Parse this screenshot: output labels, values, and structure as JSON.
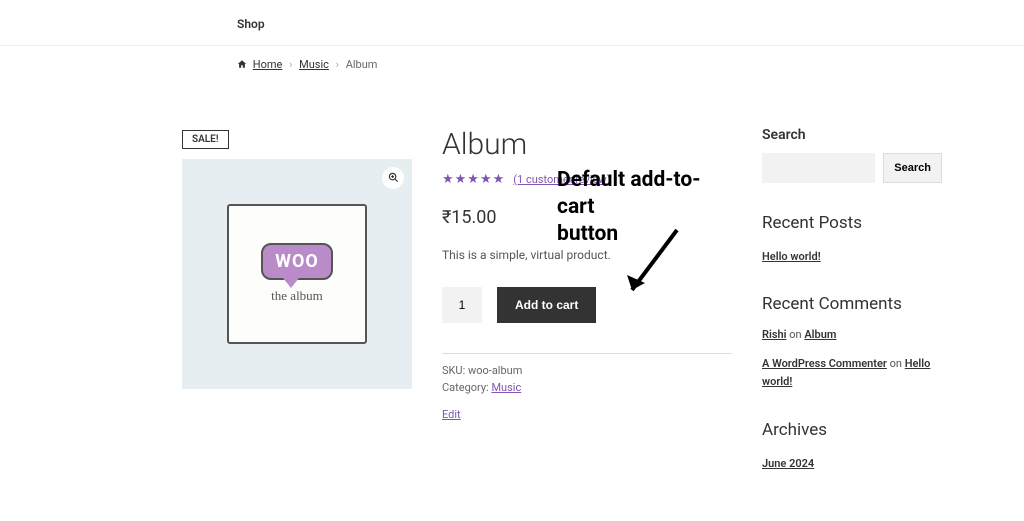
{
  "nav": {
    "shop": "Shop"
  },
  "breadcrumb": {
    "home": "Home",
    "music": "Music",
    "current": "Album"
  },
  "product": {
    "sale_badge": "SALE!",
    "title": "Album",
    "star_glyphs": "★★★★★",
    "review_link": "(1 customer review)",
    "price": "₹15.00",
    "description": "This is a simple, virtual product.",
    "qty": "1",
    "add_to_cart": "Add to cart",
    "sku_label": "SKU:",
    "sku_value": "woo-album",
    "category_label": "Category:",
    "category_value": "Music",
    "edit": "Edit",
    "art_text": "WOO",
    "art_subtitle": "the   album"
  },
  "sidebar": {
    "search_heading": "Search",
    "search_button": "Search",
    "recent_posts_heading": "Recent Posts",
    "recent_post_1": "Hello world!",
    "recent_comments_heading": "Recent Comments",
    "comment_1_author": "Rishi",
    "comment_on": "on",
    "comment_1_post": "Album",
    "comment_2_author": "A WordPress Commenter",
    "comment_2_post": "Hello world!",
    "archives_heading": "Archives",
    "archive_1": "June 2024"
  },
  "annotation": {
    "line1": "Default add-to-cart",
    "line2": "button"
  }
}
